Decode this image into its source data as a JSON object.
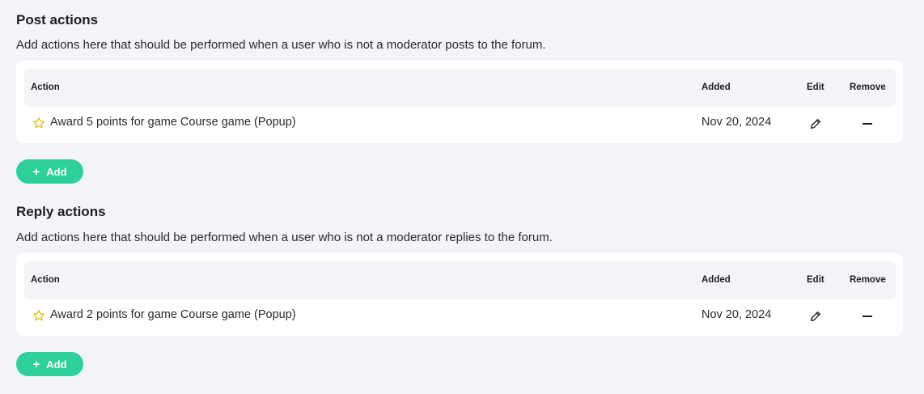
{
  "post": {
    "title": "Post actions",
    "description": "Add actions here that should be performed when a user who is not a moderator posts to the forum.",
    "columns": {
      "action": "Action",
      "added": "Added",
      "edit": "Edit",
      "remove": "Remove"
    },
    "row": {
      "action": "Award 5 points for game Course game (Popup)",
      "added": "Nov 20, 2024"
    },
    "add_label": "Add"
  },
  "reply": {
    "title": "Reply actions",
    "description": "Add actions here that should be performed when a user who is not a moderator replies to the forum.",
    "columns": {
      "action": "Action",
      "added": "Added",
      "edit": "Edit",
      "remove": "Remove"
    },
    "row": {
      "action": "Award 2 points for game Course game (Popup)",
      "added": "Nov 20, 2024"
    },
    "add_label": "Add"
  },
  "colors": {
    "accent": "#2ecf9b",
    "star": "#e6b800",
    "page_bg": "#f3f4f8"
  },
  "icons": {
    "row_icon": "star-outline-icon",
    "edit": "pencil-icon",
    "remove": "minus-icon",
    "add": "plus-icon"
  }
}
